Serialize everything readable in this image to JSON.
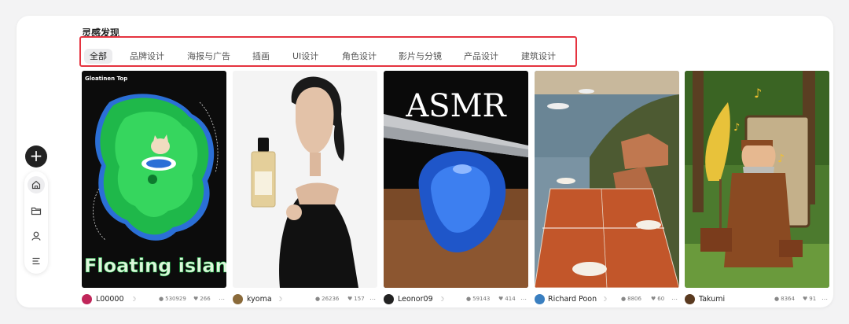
{
  "section_title": "灵感发现",
  "tabs": [
    {
      "label": "全部",
      "active": true
    },
    {
      "label": "品牌设计"
    },
    {
      "label": "海报与广告"
    },
    {
      "label": "插画"
    },
    {
      "label": "UI设计"
    },
    {
      "label": "角色设计"
    },
    {
      "label": "影片与分镜"
    },
    {
      "label": "产品设计"
    },
    {
      "label": "建筑设计"
    }
  ],
  "sidebar": {
    "create": "+",
    "items": [
      "home-icon",
      "folder-icon",
      "user-icon",
      "menu-icon"
    ]
  },
  "cards": [
    {
      "top_label": "Gloatinen Top",
      "caption": "Floating island",
      "user": "L00000",
      "views": "530929",
      "likes": "266",
      "avatar_color": "#c0265a"
    },
    {
      "user": "kyoma",
      "views": "26236",
      "likes": "157",
      "avatar_color": "#8a6a3a"
    },
    {
      "overlay": "ASMR",
      "user": "Leonor09",
      "views": "59143",
      "likes": "414",
      "avatar_color": "#222222"
    },
    {
      "user": "Richard Poon",
      "views": "8806",
      "likes": "60",
      "avatar_color": "#3a7fc0"
    },
    {
      "user": "Takumi",
      "views": "8364",
      "likes": "91",
      "avatar_color": "#5a3a20"
    }
  ],
  "colors": {
    "accent_border": "#e5333f",
    "active_tab_bg": "#ececee"
  }
}
